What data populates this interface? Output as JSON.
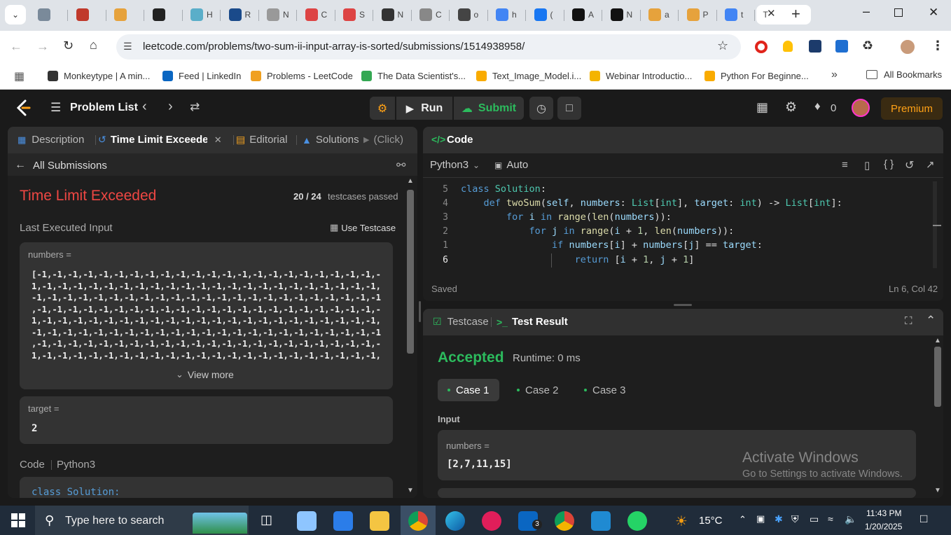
{
  "browser": {
    "tabs": [
      "",
      "",
      "",
      "",
      "H",
      "R",
      "N",
      "C",
      "S",
      "N",
      "C",
      "o",
      "h",
      "(",
      "A",
      "N",
      "a",
      "P",
      "t",
      "T"
    ],
    "active_tab_index": 19,
    "url": "leetcode.com/problems/two-sum-ii-input-array-is-sorted/submissions/1514938958/",
    "bookmarks": [
      {
        "label": "Monkeytype | A min...",
        "color": "#333333"
      },
      {
        "label": "Feed | LinkedIn",
        "color": "#0a66c2"
      },
      {
        "label": "Problems - LeetCode",
        "color": "#f0a020"
      },
      {
        "label": "The Data Scientist's...",
        "color": "#34a853"
      },
      {
        "label": "Text_Image_Model.i...",
        "color": "#f9ab00"
      },
      {
        "label": "Webinar Introductio...",
        "color": "#f4b400"
      },
      {
        "label": "Python For Beginne...",
        "color": "#f9ab00"
      }
    ],
    "all_bookmarks": "All Bookmarks"
  },
  "lc": {
    "problem_list": "Problem List",
    "run": "Run",
    "submit": "Submit",
    "streak": "0",
    "premium": "Premium"
  },
  "left": {
    "tabs": {
      "description": "Description",
      "tle": "Time Limit Exceeded",
      "editorial": "Editorial",
      "solutions": "Solutions",
      "click": "(Click)"
    },
    "all_submissions": "All Submissions",
    "status": "Time Limit Exceeded",
    "passed": "20 / 24",
    "passed_suffix": "testcases passed",
    "last_input": "Last Executed Input",
    "use_testcase": "Use Testcase",
    "numbers_label": "numbers =",
    "numbers_lines": [
      "[-1,-1,-1,-1,-1,-1,-1,-1,-1,-1,-1,-1,-1,-1,-1,-1,-1,-1,-1,-1,-1,-1,-",
      "1,-1,-1,-1,-1,-1,-1,-1,-1,-1,-1,-1,-1,-1,-1,-1,-1,-1,-1,-1,-1,-1,-1,",
      "-1,-1,-1,-1,-1,-1,-1,-1,-1,-1,-1,-1,-1,-1,-1,-1,-1,-1,-1,-1,-1,-1,-1",
      ",-1,-1,-1,-1,-1,-1,-1,-1,-1,-1,-1,-1,-1,-1,-1,-1,-1,-1,-1,-1,-1,-1,-",
      "1,-1,-1,-1,-1,-1,-1,-1,-1,-1,-1,-1,-1,-1,-1,-1,-1,-1,-1,-1,-1,-1,-1,",
      "-1,-1,-1,-1,-1,-1,-1,-1,-1,-1,-1,-1,-1,-1,-1,-1,-1,-1,-1,-1,-1,-1,-1",
      ",-1,-1,-1,-1,-1,-1,-1,-1,-1,-1,-1,-1,-1,-1,-1,-1,-1,-1,-1,-1,-1,-1,-",
      "1,-1,-1,-1,-1,-1,-1,-1,-1,-1,-1,-1,-1,-1,-1,-1,-1,-1,-1,-1,-1,-1,-1,"
    ],
    "view_more": "View more",
    "target_label": "target =",
    "target_value": "2",
    "code_label": "Code",
    "code_lang": "Python3",
    "code_first_line": "class Solution:"
  },
  "editor": {
    "title": "Code",
    "lang": "Python3",
    "auto": "Auto",
    "line_numbers": [
      "5",
      "4",
      "3",
      "2",
      "1",
      "6"
    ],
    "saved": "Saved",
    "cursor": "Ln 6, Col 42"
  },
  "result": {
    "testcase_tab": "Testcase",
    "result_tab": "Test Result",
    "status": "Accepted",
    "runtime": "Runtime: 0 ms",
    "cases": [
      "Case 1",
      "Case 2",
      "Case 3"
    ],
    "input_label": "Input",
    "numbers_label": "numbers =",
    "numbers_value": "[2,7,11,15]",
    "watermark_title": "Activate Windows",
    "watermark_sub": "Go to Settings to activate Windows."
  },
  "taskbar": {
    "search": "Type here to search",
    "weather": "15°C",
    "time": "11:43 PM",
    "date": "1/20/2025",
    "linkedin_badge": "3"
  }
}
